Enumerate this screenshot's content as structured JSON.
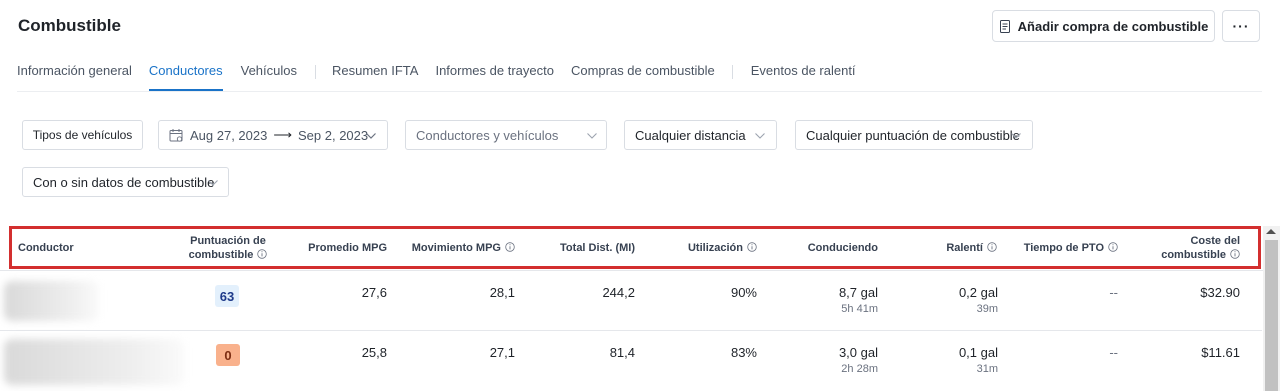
{
  "header": {
    "title": "Combustible",
    "add_button_label": "Añadir compra de combustible",
    "more_label": "···"
  },
  "tabs": [
    {
      "label": "Información general",
      "active": false
    },
    {
      "label": "Conductores",
      "active": true
    },
    {
      "label": "Vehículos",
      "active": false
    },
    {
      "label": "Resumen IFTA",
      "active": false
    },
    {
      "label": "Informes de trayecto",
      "active": false
    },
    {
      "label": "Compras de combustible",
      "active": false
    },
    {
      "label": "Eventos de ralentí",
      "active": false
    }
  ],
  "filters": {
    "vehicle_types": "Tipos de vehículos",
    "date_start": "Aug 27, 2023",
    "date_arrow": "⟶",
    "date_end": "Sep 2, 2023",
    "drivers_vehicles_placeholder": "Conductores y vehículos",
    "distance": "Cualquier distancia",
    "fuel_score": "Cualquier puntuación de combustible",
    "fuel_data": "Con o sin datos de combustible"
  },
  "table": {
    "columns": {
      "driver": "Conductor",
      "score_1": "Puntuación de",
      "score_2": "combustible",
      "avg_mpg": "Promedio MPG",
      "moving_mpg": "Movimiento MPG",
      "total_dist": "Total Dist. (MI)",
      "utilization": "Utilización",
      "driving": "Conduciendo",
      "idle": "Ralentí",
      "pto_time": "Tiempo de PTO",
      "fuel_cost_1": "Coste del",
      "fuel_cost_2": "combustible"
    },
    "rows": [
      {
        "score": "63",
        "avg_mpg": "27,6",
        "moving_mpg": "28,1",
        "total_dist": "244,2",
        "utilization": "90%",
        "driving_gal": "8,7 gal",
        "driving_time": "5h 41m",
        "idle_gal": "0,2 gal",
        "idle_time": "39m",
        "pto": "--",
        "cost": "$32.90"
      },
      {
        "score": "0",
        "avg_mpg": "25,8",
        "moving_mpg": "27,1",
        "total_dist": "81,4",
        "utilization": "83%",
        "driving_gal": "3,0 gal",
        "driving_time": "2h 28m",
        "idle_gal": "0,1 gal",
        "idle_time": "31m",
        "pto": "--",
        "cost": "$11.61"
      }
    ]
  },
  "colors": {
    "accent": "#1a73c8",
    "highlight": "#d32f2f",
    "score_good_bg": "#e3f0fc",
    "score_good_fg": "#1e3a8a",
    "score_bad_bg": "#f9b18c",
    "score_bad_fg": "#7c2d12"
  }
}
